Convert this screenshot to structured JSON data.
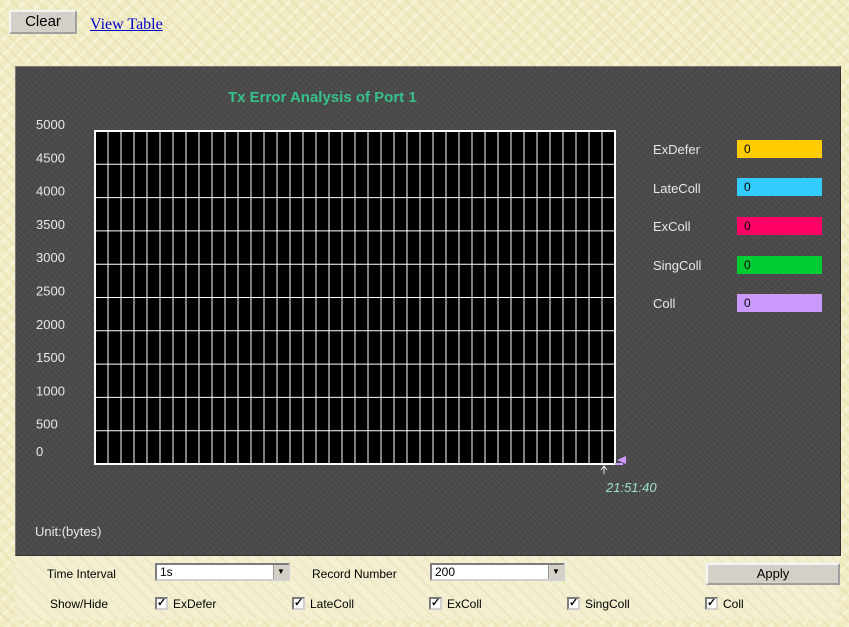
{
  "toolbar": {
    "clear_label": "Clear",
    "view_table_label": "View Table"
  },
  "chart": {
    "title": "Tx Error Analysis of Port 1",
    "unit_label": "Unit:(bytes)",
    "time_label": "21:51:40",
    "legend": [
      {
        "name": "ExDefer",
        "value": "0",
        "color": "#ffcc00",
        "text_color": "#000000"
      },
      {
        "name": "LateColl",
        "value": "0",
        "color": "#33ccff",
        "text_color": "#000000"
      },
      {
        "name": "ExColl",
        "value": "0",
        "color": "#ff0066",
        "text_color": "#000000"
      },
      {
        "name": "SingColl",
        "value": "0",
        "color": "#00cc33",
        "text_color": "#000000"
      },
      {
        "name": "Coll",
        "value": "0",
        "color": "#cc99ff",
        "text_color": "#000000"
      }
    ]
  },
  "chart_data": {
    "type": "line",
    "title": "Tx Error Analysis of Port 1",
    "ylabel": "Unit:(bytes)",
    "ylim": [
      0,
      5000
    ],
    "y_ticks": [
      "5000",
      "4500",
      "4000",
      "3500",
      "3000",
      "2500",
      "2000",
      "1500",
      "1000",
      "500",
      "0"
    ],
    "x_label": "21:51:40",
    "grid": true,
    "series": [
      {
        "name": "ExDefer",
        "color": "#ffcc00",
        "values": [
          0
        ]
      },
      {
        "name": "LateColl",
        "color": "#33ccff",
        "values": [
          0
        ]
      },
      {
        "name": "ExColl",
        "color": "#ff0066",
        "values": [
          0
        ]
      },
      {
        "name": "SingColl",
        "color": "#00cc33",
        "values": [
          0
        ]
      },
      {
        "name": "Coll",
        "color": "#cc99ff",
        "values": [
          0
        ]
      }
    ]
  },
  "controls": {
    "time_interval_label": "Time Interval",
    "time_interval_value": "1s",
    "record_number_label": "Record Number",
    "record_number_value": "200",
    "apply_label": "Apply",
    "show_hide_label": "Show/Hide",
    "checkboxes": [
      {
        "label": "ExDefer",
        "checked": true
      },
      {
        "label": "LateColl",
        "checked": true
      },
      {
        "label": "ExColl",
        "checked": true
      },
      {
        "label": "SingColl",
        "checked": true
      },
      {
        "label": "Coll",
        "checked": true
      }
    ]
  }
}
